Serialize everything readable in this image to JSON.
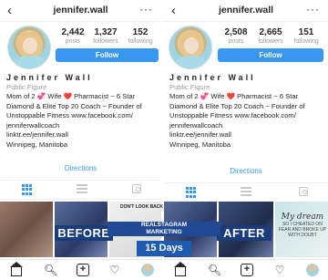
{
  "left": {
    "username": "jennifer.wall",
    "stats": [
      {
        "value": "2,442",
        "label": "posts"
      },
      {
        "value": "1,327",
        "label": "followers"
      },
      {
        "value": "152",
        "label": "following"
      }
    ],
    "follow_label": "Follow",
    "bio": {
      "name": "Jennifer  Wall",
      "category": "Public Figure",
      "lines": [
        "Mom of 2 💞 Wife ❤️ Pharmacist ~ 6 Star",
        "Diamond & Elite Top 20 Coach ~ Founder of",
        "Unstoppable Fitness www.facebook.com/",
        "jenniferwallcoach",
        "linktr.ee/jennifer.wall",
        "Winnipeg, Manitoba"
      ]
    },
    "directions_label": "Directions"
  },
  "right": {
    "username": "jennifer.wall",
    "stats": [
      {
        "value": "2,508",
        "label": "posts"
      },
      {
        "value": "2,665",
        "label": "followers"
      },
      {
        "value": "151",
        "label": "following"
      }
    ],
    "follow_label": "Follow",
    "bio": {
      "name": "Jennifer  Wall",
      "category": "Public Figure",
      "lines": [
        "Mom of 2 💞 Wife ❤️ Pharmacist ~ 6 Star",
        "Diamond & Elite Top 20 Coach ~ Founder of",
        "Unstoppable Fitness www.facebook.com/",
        "jenniferwallcoach",
        "linktr.ee/jennifer.wall",
        "Winnipeg, Manitoba"
      ]
    },
    "directions_label": "Directions"
  },
  "overlay": {
    "before": "BEFORE",
    "after": "AFTER",
    "promo_line1": "REALSTAGRAM",
    "promo_line2": "MARKETING",
    "promo_days": "15 Days",
    "dont_look": "DON'T LOOK BACK",
    "quote_script": "My dream",
    "quote_small": "SO I CHEATED ON FEAR AND BROKE UP WITH DOUBT"
  },
  "colors": {
    "accent": "#3897f0",
    "overlay_blue": "#1a3c7b",
    "heart": "#e0245e"
  },
  "icons": {
    "back": "chevron-left-icon",
    "more": "more-dots-icon",
    "grid": "grid-icon",
    "list": "list-icon",
    "tagged": "tagged-icon",
    "home": "home-icon",
    "search": "search-icon",
    "add": "add-post-icon",
    "activity": "heart-icon",
    "profile": "profile-avatar-icon"
  }
}
